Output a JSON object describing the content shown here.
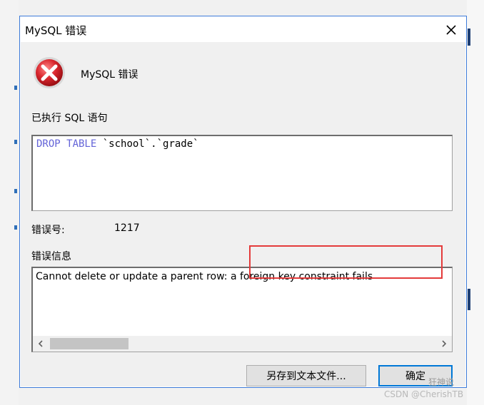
{
  "dialog": {
    "title": "MySQL 错误",
    "header": "MySQL 错误",
    "executed_sql_label": "已执行 SQL 语句",
    "sql_keyword": "DROP TABLE",
    "sql_rest": " `school`.`grade`",
    "error_code_label": "错误号:",
    "error_code": "1217",
    "error_info_label": "错误信息",
    "error_message": "Cannot delete or update a parent row: a foreign key constraint fails",
    "save_button": "另存到文本文件...",
    "ok_button": "确定"
  },
  "icons": {
    "close": "close-icon",
    "error": "error-icon",
    "scroll_left": "chevron-left-icon",
    "scroll_right": "chevron-right-icon"
  },
  "colors": {
    "accent": "#0078d7",
    "error_red": "#d9272e",
    "highlight_red": "#e43b3b",
    "sql_keyword": "#6464d8"
  },
  "watermark": {
    "line1": "狂神说",
    "line2": "CSDN @CherishTB"
  }
}
